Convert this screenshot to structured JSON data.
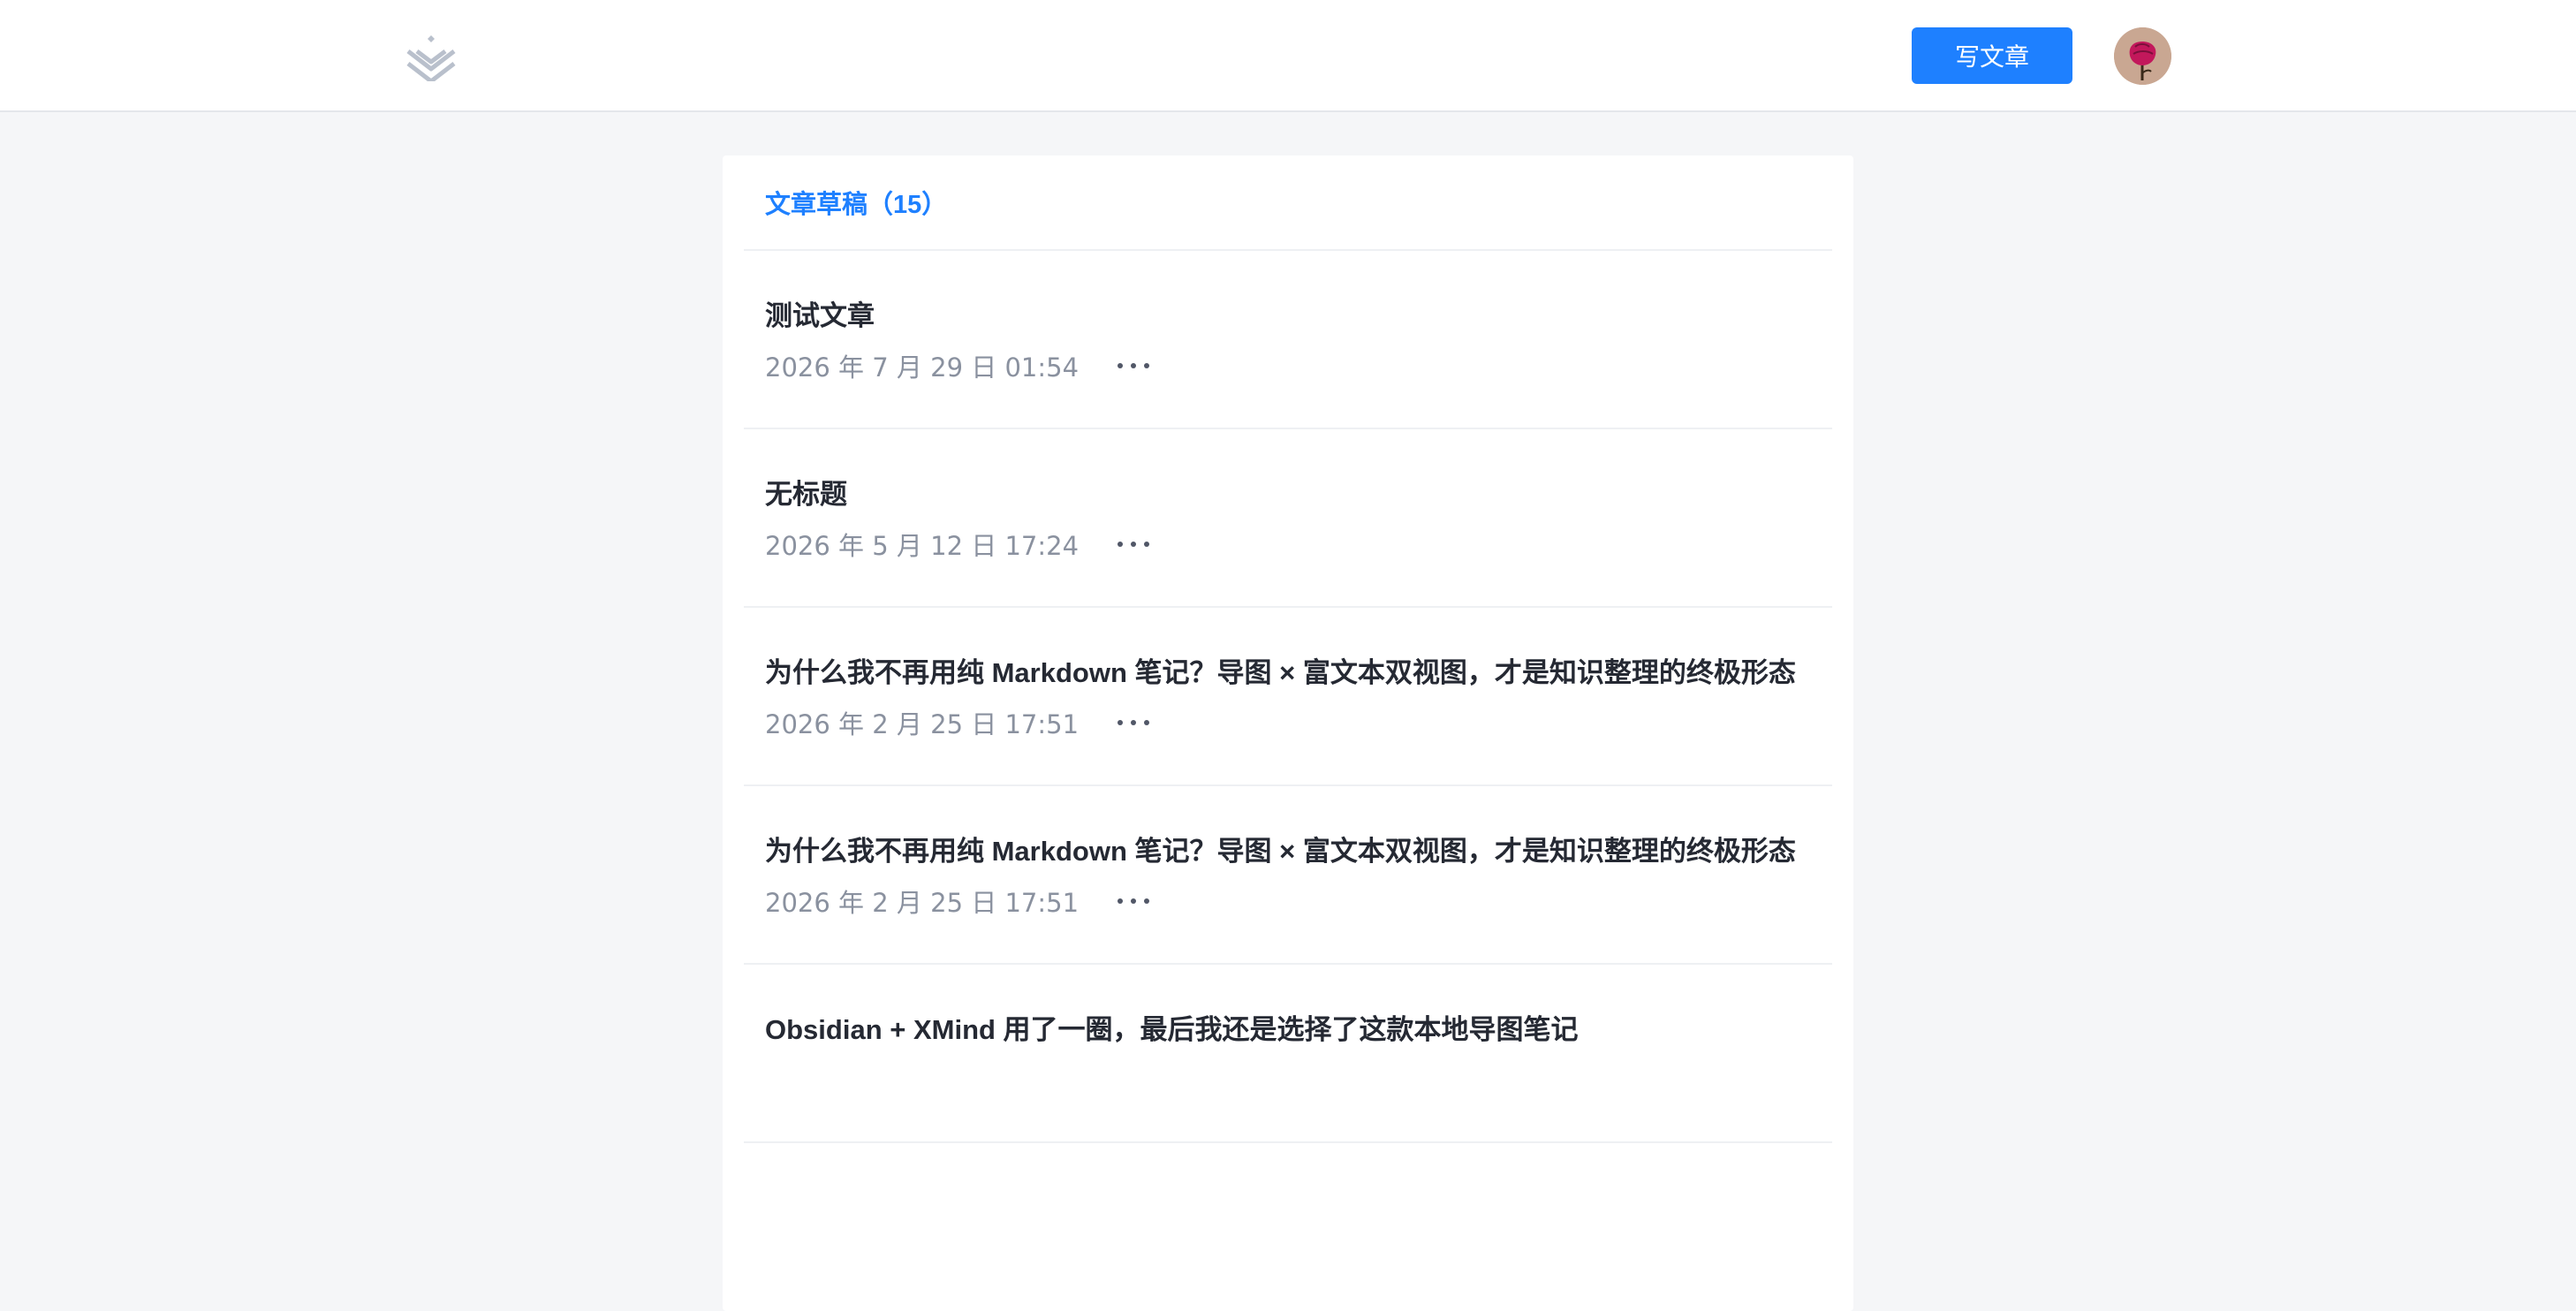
{
  "header": {
    "logo_icon": "juejin-logo-icon",
    "write_button_label": "写文章",
    "avatar_icon": "user-avatar",
    "accent_color": "#1e80ff"
  },
  "panel": {
    "title": "文章草稿（15）",
    "drafts": [
      {
        "title": "测试文章",
        "date": "2026 年 7 月 29 日 01:54"
      },
      {
        "title": "无标题",
        "date": "2026 年 5 月 12 日 17:24"
      },
      {
        "title": "为什么我不再用纯 Markdown 笔记？导图 × 富文本双视图，才是知识整理的终极形态",
        "date": "2026 年 2 月 25 日 17:51"
      },
      {
        "title": "为什么我不再用纯 Markdown 笔记？导图 × 富文本双视图，才是知识整理的终极形态",
        "date": "2026 年 2 月 25 日 17:51"
      },
      {
        "title": "Obsidian + XMind 用了一圈，最后我还是选择了这款本地导图笔记",
        "date": ""
      }
    ]
  }
}
